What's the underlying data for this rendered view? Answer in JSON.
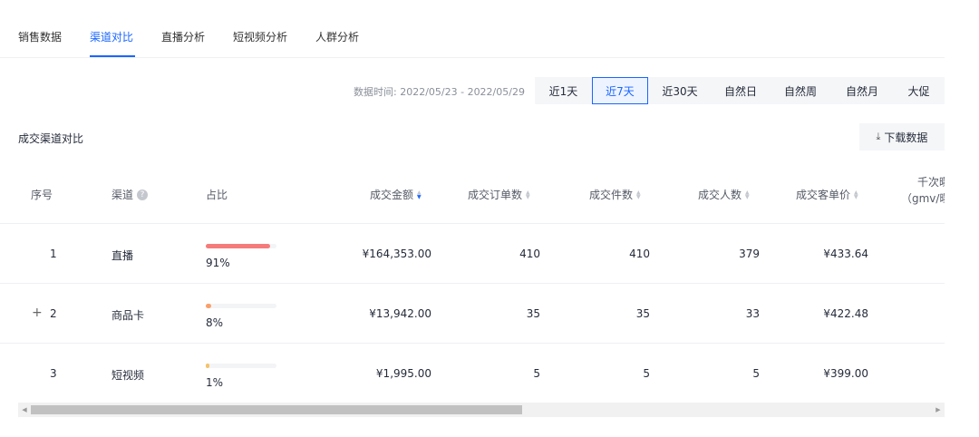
{
  "tabs": [
    {
      "label": "销售数据"
    },
    {
      "label": "渠道对比"
    },
    {
      "label": "直播分析"
    },
    {
      "label": "短视频分析"
    },
    {
      "label": "人群分析"
    }
  ],
  "active_tab": "渠道对比",
  "toolbar": {
    "data_time": "数据时间: 2022/05/23 - 2022/05/29",
    "ranges": [
      "近1天",
      "近7天",
      "近30天",
      "自然日",
      "自然周",
      "自然月",
      "大促"
    ],
    "active_range": "近7天"
  },
  "section": {
    "title": "成交渠道对比",
    "download_label": "下载数据"
  },
  "table": {
    "headers": {
      "index": "序号",
      "channel": "渠道",
      "share": "占比",
      "gmv": "成交金额",
      "orders": "成交订单数",
      "items": "成交件数",
      "buyers": "成交人数",
      "avg_price": "成交客单价",
      "gpm_line1": "千次曝",
      "gpm_line2": "（gmv/曝"
    },
    "sorted_column": "成交金额",
    "sort_direction": "descending",
    "rows": [
      {
        "index": "1",
        "channel": "直播",
        "share_label": "91%",
        "share": 0.91,
        "bar_color": "#f57b7b",
        "gmv": "¥164,353.00",
        "orders": "410",
        "items": "410",
        "buyers": "379",
        "avg_price": "¥433.64",
        "expandable": false
      },
      {
        "index": "2",
        "channel": "商品卡",
        "share_label": "8%",
        "share": 0.08,
        "bar_color": "#f9a06a",
        "gmv": "¥13,942.00",
        "orders": "35",
        "items": "35",
        "buyers": "33",
        "avg_price": "¥422.48",
        "expandable": true
      },
      {
        "index": "3",
        "channel": "短视频",
        "share_label": "1%",
        "share": 0.01,
        "bar_color": "#f5c36b",
        "gmv": "¥1,995.00",
        "orders": "5",
        "items": "5",
        "buyers": "5",
        "avg_price": "¥399.00",
        "expandable": false
      }
    ]
  },
  "scrollbar": {
    "position": 0.0
  }
}
